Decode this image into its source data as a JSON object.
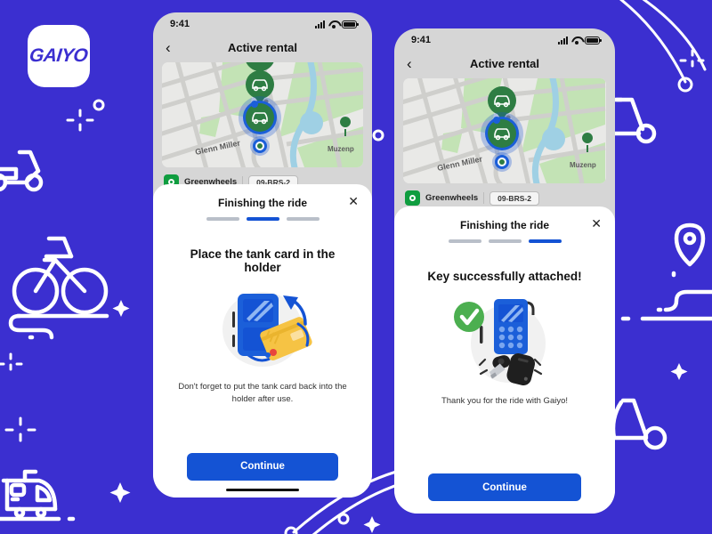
{
  "brand": {
    "logo_text": "GAIYO",
    "background_color": "#3b2fd0",
    "accent_color": "#1453d4",
    "success_color": "#4caf50",
    "provider_color": "#0f9d3f"
  },
  "screens": [
    {
      "id": "screen-tank-card",
      "status_bar": {
        "time": "9:41",
        "signal_icon": "cellular-signal-icon",
        "wifi_icon": "wifi-icon",
        "battery_icon": "battery-icon"
      },
      "nav": {
        "back_icon": "chevron-left-icon",
        "title": "Active rental"
      },
      "map": {
        "street_label": "Glenn Miller",
        "place_label": "Muzenp",
        "marker_icons": [
          "car-marker-green",
          "car-marker-blue",
          "location-dot-marker"
        ]
      },
      "vehicle": {
        "provider": "Greenwheels",
        "plate": "09-BRS-2",
        "provider_icon": "greenwheels-logo-icon"
      },
      "sheet": {
        "title": "Finishing the ride",
        "close_icon": "close-icon",
        "steps_total": 3,
        "active_step": 2,
        "headline": "Place the tank card in the holder",
        "illustration": "tank-card-holder-illustration",
        "subtext": "Don't forget to put the tank card back into the holder after use.",
        "button": "Continue"
      }
    },
    {
      "id": "screen-key-attached",
      "status_bar": {
        "time": "9:41",
        "signal_icon": "cellular-signal-icon",
        "wifi_icon": "wifi-icon",
        "battery_icon": "battery-icon"
      },
      "nav": {
        "back_icon": "chevron-left-icon",
        "title": "Active rental"
      },
      "map": {
        "street_label": "Glenn Miller",
        "place_label": "Muzenp",
        "marker_icons": [
          "car-marker-green",
          "car-marker-blue",
          "location-dot-marker"
        ]
      },
      "vehicle": {
        "provider": "Greenwheels",
        "plate": "09-BRS-2",
        "provider_icon": "greenwheels-logo-icon"
      },
      "sheet": {
        "title": "Finishing the ride",
        "close_icon": "close-icon",
        "steps_total": 3,
        "active_step": 3,
        "headline": "Key successfully attached!",
        "illustration": "key-fob-device-illustration",
        "subtext": "Thank you for the ride with Gaiyo!",
        "button": "Continue"
      }
    }
  ],
  "decorations": {
    "icons": [
      "scooter-icon",
      "bicycle-icon",
      "train-icon",
      "kick-scooter-icon",
      "location-pin-icon",
      "sparkle-icon",
      "arc-line-icon"
    ]
  }
}
